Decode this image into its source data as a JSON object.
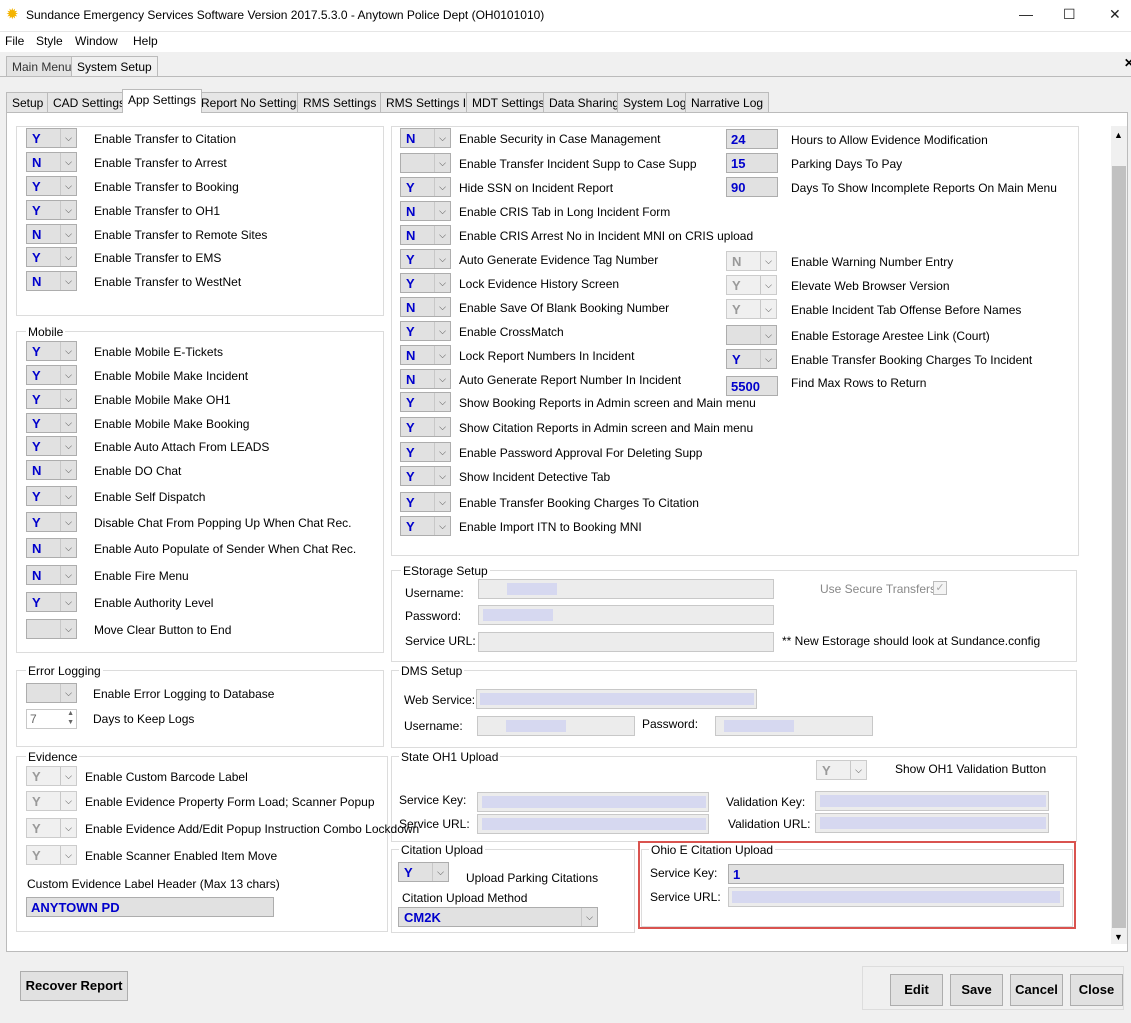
{
  "window": {
    "title": "Sundance Emergency Services Software Version 2017.5.3.0 - Anytown Police Dept (OH0101010)",
    "min": "—",
    "max": "☐",
    "close": "✕"
  },
  "menu": [
    "File",
    "Style",
    "Window",
    "Help"
  ],
  "app_tabs": [
    "Main Menu",
    "System Setup"
  ],
  "tabs": [
    "Setup",
    "CAD Settings",
    "App Settings",
    "Report No Settings",
    "RMS Settings I",
    "RMS Settings II",
    "MDT Settings",
    "Data Sharing",
    "System Log",
    "Narrative Log"
  ],
  "transfer": [
    {
      "v": "Y",
      "l": "Enable Transfer to Citation"
    },
    {
      "v": "N",
      "l": "Enable Transfer to Arrest"
    },
    {
      "v": "Y",
      "l": "Enable Transfer to Booking"
    },
    {
      "v": "Y",
      "l": "Enable Transfer to OH1"
    },
    {
      "v": "N",
      "l": "Enable Transfer to Remote Sites"
    },
    {
      "v": "Y",
      "l": "Enable Transfer to EMS"
    },
    {
      "v": "N",
      "l": "Enable Transfer to WestNet"
    }
  ],
  "mobile": {
    "title": "Mobile",
    "items": [
      {
        "v": "Y",
        "l": "Enable Mobile E-Tickets"
      },
      {
        "v": "Y",
        "l": "Enable Mobile Make Incident"
      },
      {
        "v": "Y",
        "l": "Enable Mobile Make OH1"
      },
      {
        "v": "Y",
        "l": "Enable Mobile Make Booking"
      },
      {
        "v": "Y",
        "l": "Enable Auto Attach From LEADS"
      },
      {
        "v": "N",
        "l": "Enable DO Chat"
      },
      {
        "v": "Y",
        "l": "Enable Self Dispatch"
      },
      {
        "v": "Y",
        "l": "Disable Chat From Popping Up When Chat Rec."
      },
      {
        "v": "N",
        "l": "Enable Auto Populate of Sender When Chat Rec."
      },
      {
        "v": "N",
        "l": "Enable Fire Menu"
      },
      {
        "v": "Y",
        "l": "Enable Authority Level"
      },
      {
        "v": "",
        "l": "Move Clear Button to End"
      }
    ]
  },
  "error": {
    "title": "Error Logging",
    "db_label": "Enable Error Logging to Database",
    "db_value": "",
    "days_value": "7",
    "days_label": "Days to Keep Logs"
  },
  "evidence": {
    "title": "Evidence",
    "items": [
      {
        "v": "Y",
        "l": "Enable Custom Barcode Label"
      },
      {
        "v": "Y",
        "l": "Enable Evidence Property Form Load; Scanner Popup"
      },
      {
        "v": "Y",
        "l": "Enable Evidence Add/Edit Popup Instruction Combo Lockdown"
      },
      {
        "v": "Y",
        "l": "Enable Scanner Enabled Item Move"
      }
    ],
    "header_label": "Custom Evidence Label Header (Max 13 chars)",
    "header_value": "ANYTOWN PD"
  },
  "mid": [
    {
      "v": "N",
      "l": "Enable Security in Case Management"
    },
    {
      "v": "",
      "l": "Enable Transfer Incident Supp to Case Supp"
    },
    {
      "v": "Y",
      "l": "Hide SSN on Incident Report"
    },
    {
      "v": "N",
      "l": "Enable CRIS Tab in Long Incident Form"
    },
    {
      "v": "N",
      "l": "Enable CRIS Arrest No in Incident MNI on CRIS upload"
    },
    {
      "v": "Y",
      "l": "Auto Generate Evidence Tag Number"
    },
    {
      "v": "Y",
      "l": "Lock Evidence History Screen"
    },
    {
      "v": "N",
      "l": "Enable Save Of Blank Booking Number"
    },
    {
      "v": "Y",
      "l": "Enable CrossMatch"
    },
    {
      "v": "N",
      "l": "Lock Report Numbers In Incident"
    },
    {
      "v": "N",
      "l": "Auto Generate Report Number In Incident"
    },
    {
      "v": "Y",
      "l": "Show Booking Reports in Admin screen and Main menu"
    },
    {
      "v": "Y",
      "l": "Show Citation Reports in Admin screen and Main menu"
    },
    {
      "v": "Y",
      "l": "Enable Password Approval For Deleting Supp"
    },
    {
      "v": "Y",
      "l": "Show Incident Detective Tab"
    },
    {
      "v": "Y",
      "l": "Enable Transfer Booking Charges To Citation"
    },
    {
      "v": "Y",
      "l": "Enable Import ITN to Booking MNI"
    }
  ],
  "right_nums": [
    {
      "v": "24",
      "l": "Hours to Allow Evidence Modification"
    },
    {
      "v": "15",
      "l": "Parking Days To Pay"
    },
    {
      "v": "90",
      "l": "Days To Show Incomplete Reports On Main Menu"
    }
  ],
  "right_combos": [
    {
      "v": "N",
      "l": "Enable Warning Number Entry",
      "dis": true
    },
    {
      "v": "Y",
      "l": "Elevate Web Browser Version",
      "dis": true
    },
    {
      "v": "Y",
      "l": "Enable Incident Tab Offense Before Names",
      "dis": true
    },
    {
      "v": "",
      "l": "Enable Estorage Arestee Link (Court)",
      "dis": false
    },
    {
      "v": "Y",
      "l": "Enable Transfer Booking Charges To Incident",
      "dis": false
    }
  ],
  "maxrows": {
    "v": "5500",
    "l": "Find Max Rows to Return"
  },
  "estorage": {
    "title": "EStorage Setup",
    "user": "Username:",
    "pass": "Password:",
    "url": "Service URL:",
    "secure": "Use Secure Transfers:",
    "note": "** New Estorage should look at Sundance.config"
  },
  "dms": {
    "title": "DMS Setup",
    "ws": "Web Service:",
    "user": "Username:",
    "pass": "Password:"
  },
  "oh1": {
    "title": "State OH1 Upload",
    "v": "Y",
    "btn_label": "Show OH1 Validation Button",
    "key": "Service Key:",
    "url": "Service URL:",
    "vkey": "Validation Key:",
    "vurl": "Validation URL:"
  },
  "citation": {
    "title": "Citation Upload",
    "v": "Y",
    "parking": "Upload Parking Citations",
    "method_label": "Citation Upload Method",
    "method": "CM2K"
  },
  "ohio": {
    "title": "Ohio E Citation Upload",
    "key": "Service Key:",
    "key_value": "1",
    "url": "Service URL:"
  },
  "buttons": {
    "recover": "Recover Report",
    "edit": "Edit",
    "save": "Save",
    "cancel": "Cancel",
    "close": "Close"
  },
  "colors": {
    "accent": "#0000cc",
    "highlight": "#d9534f"
  }
}
